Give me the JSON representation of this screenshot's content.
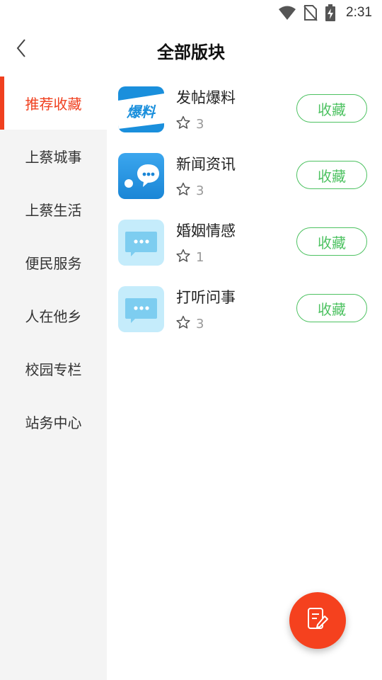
{
  "status_bar": {
    "time": "2:31",
    "icons": [
      "wifi-icon",
      "no-sim-icon",
      "battery-charging-icon"
    ]
  },
  "header": {
    "title": "全部版块",
    "back_icon": "chevron-left-icon"
  },
  "sidebar": {
    "items": [
      {
        "label": "推荐收藏",
        "active": true
      },
      {
        "label": "上蔡城事",
        "active": false
      },
      {
        "label": "上蔡生活",
        "active": false
      },
      {
        "label": "便民服务",
        "active": false
      },
      {
        "label": "人在他乡",
        "active": false
      },
      {
        "label": "校园专栏",
        "active": false
      },
      {
        "label": "站务中心",
        "active": false
      }
    ]
  },
  "boards": [
    {
      "name": "发帖爆料",
      "count": "3",
      "icon": "baoliao-logo",
      "icon_text": "爆料",
      "button": "收藏"
    },
    {
      "name": "新闻资讯",
      "count": "3",
      "icon": "chat-bubble-icon",
      "button": "收藏"
    },
    {
      "name": "婚姻情感",
      "count": "1",
      "icon": "message-icon",
      "button": "收藏"
    },
    {
      "name": "打听问事",
      "count": "3",
      "icon": "message-icon",
      "button": "收藏"
    }
  ],
  "fab": {
    "icon": "compose-icon"
  },
  "colors": {
    "accent_red": "#f0401f",
    "accent_green": "#4dc261",
    "sidebar_bg": "#f4f4f4",
    "icon_blue": "#1a8fdc",
    "icon_light_blue": "#c5ecfb"
  }
}
